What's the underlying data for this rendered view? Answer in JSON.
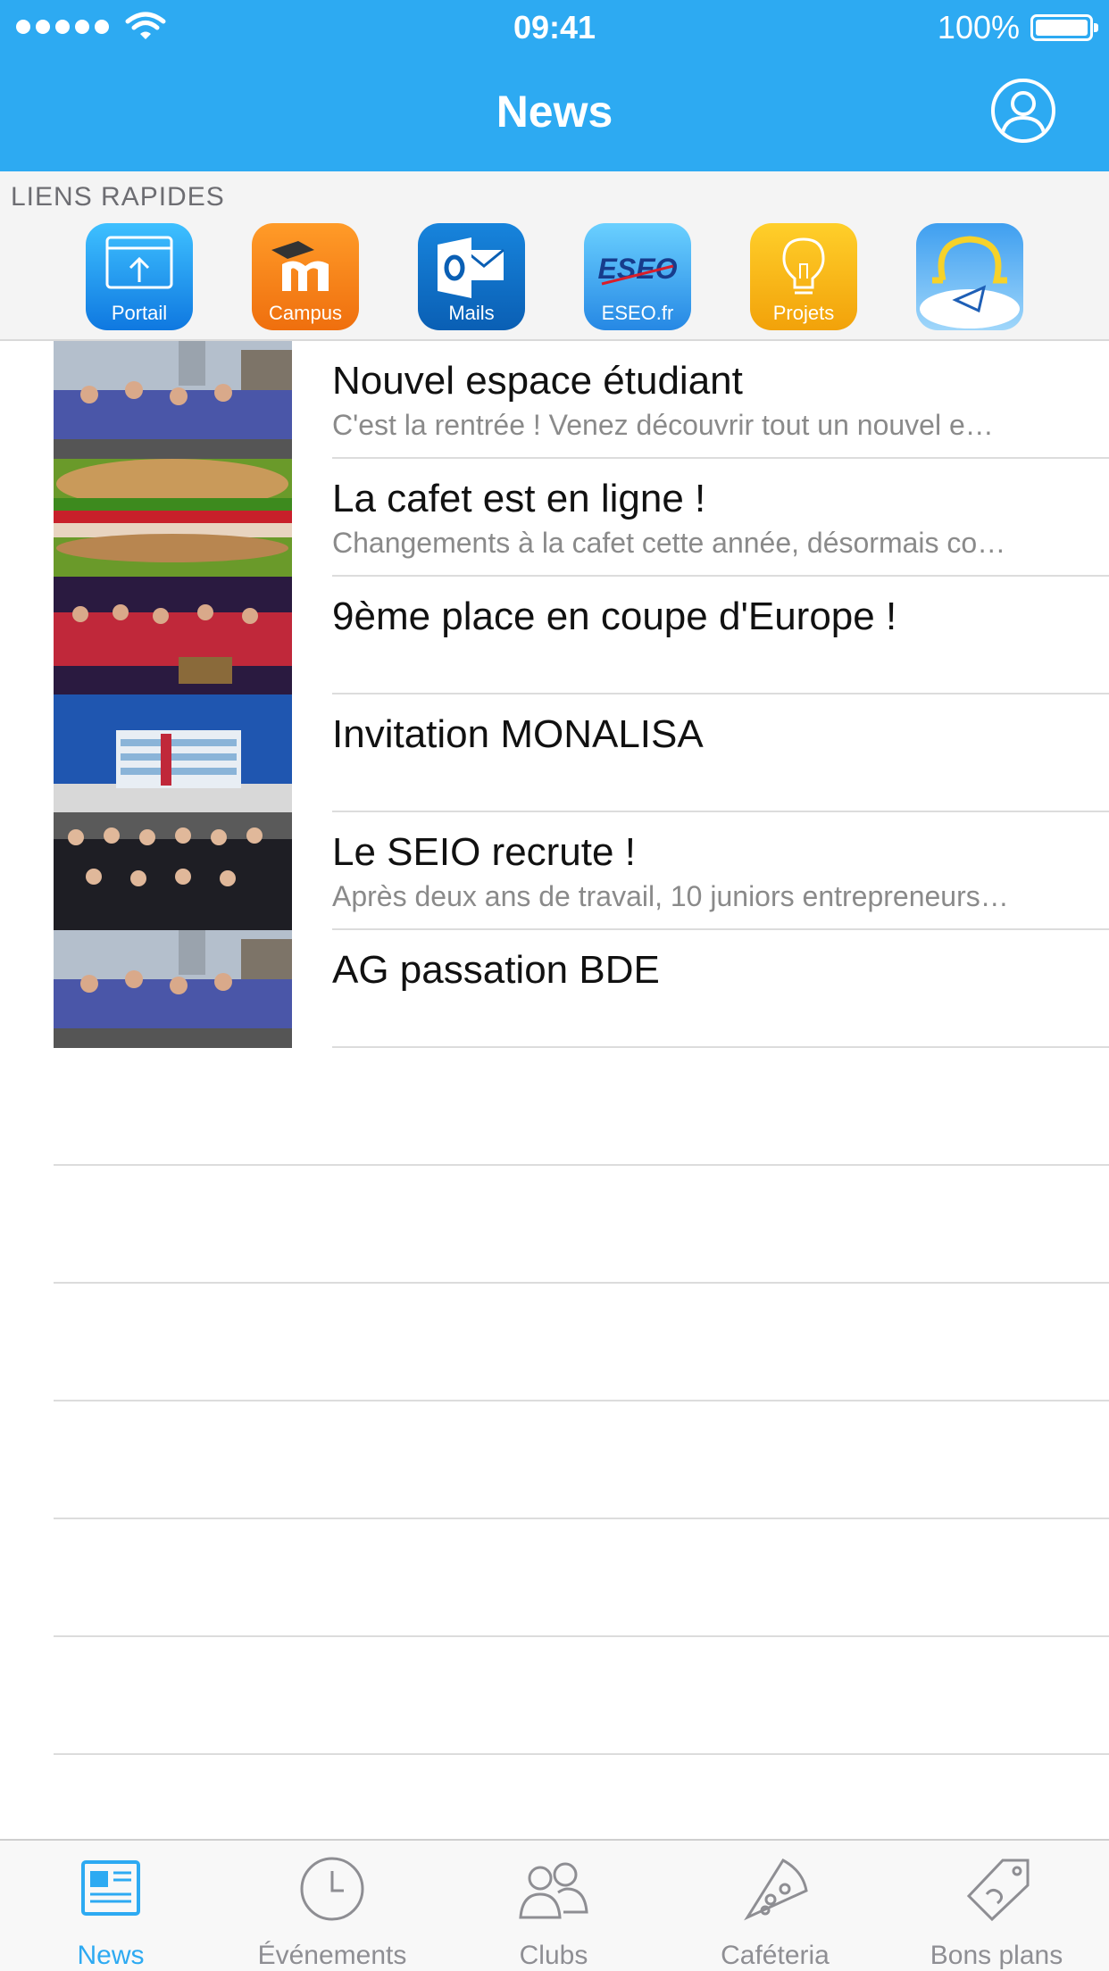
{
  "status_bar": {
    "time": "09:41",
    "battery": "100%"
  },
  "header": {
    "title": "News"
  },
  "quick_links": {
    "title": "LIENS RAPIDES",
    "items": [
      {
        "label": "Portail",
        "icon": "portal-icon",
        "color": "#1a8fe8"
      },
      {
        "label": "Campus",
        "icon": "moodle-icon",
        "color": "#f47a12"
      },
      {
        "label": "Mails",
        "icon": "outlook-icon",
        "color": "#0f6fc6"
      },
      {
        "label": "ESEO.fr",
        "icon": "eseo-logo-icon",
        "color": "#2d9de8"
      },
      {
        "label": "Projets",
        "icon": "lightbulb-icon",
        "color": "#f6b50d"
      },
      {
        "label": "",
        "icon": "omega-logo-icon",
        "color": "#4fb2ee"
      }
    ]
  },
  "news": [
    {
      "title": "Nouvel espace étudiant",
      "subtitle": "C'est la rentrée ! Venez découvrir tout un nouvel e…",
      "image": "group-photo"
    },
    {
      "title": "La cafet est en ligne !",
      "subtitle": "Changements à la cafet cette année, désormais co…",
      "image": "sandwich-photo"
    },
    {
      "title": "9ème place en coupe d'Europe !",
      "subtitle": "",
      "image": "team-photo"
    },
    {
      "title": "Invitation MONALISA",
      "subtitle": "",
      "image": "building-photo"
    },
    {
      "title": "Le SEIO recrute !",
      "subtitle": "Après deux ans de travail, 10 juniors entrepreneurs…",
      "image": "suits-photo"
    },
    {
      "title": "AG passation BDE",
      "subtitle": "",
      "image": "group-photo"
    }
  ],
  "tabbar": {
    "active_color": "#2daaf2",
    "items": [
      {
        "label": "News",
        "icon": "newspaper-icon",
        "active": true
      },
      {
        "label": "Événements",
        "icon": "clock-icon",
        "active": false
      },
      {
        "label": "Clubs",
        "icon": "people-icon",
        "active": false
      },
      {
        "label": "Caféteria",
        "icon": "pizza-icon",
        "active": false
      },
      {
        "label": "Bons plans",
        "icon": "tag-icon",
        "active": false
      }
    ]
  }
}
